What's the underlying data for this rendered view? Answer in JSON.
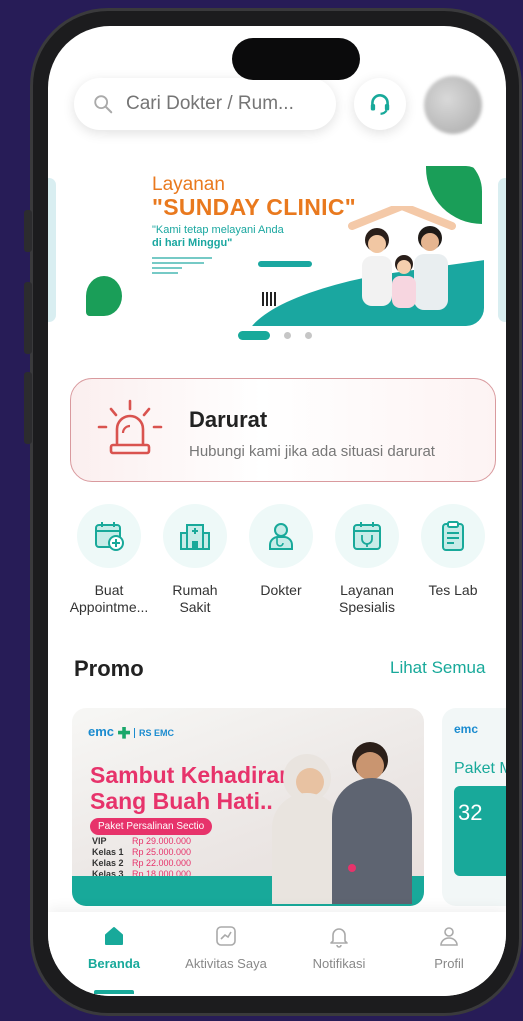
{
  "search": {
    "placeholder": "Cari Dokter / Rum..."
  },
  "banner": {
    "title_line1": "Layanan",
    "title_line2": "\"SUNDAY CLINIC\"",
    "tagline_line1": "\"Kami tetap melayani Anda",
    "tagline_line2": "di hari Minggu\"",
    "pagination": {
      "count": 3,
      "active_index": 0
    }
  },
  "emergency": {
    "title": "Darurat",
    "subtitle": "Hubungi kami jika ada situasi darurat"
  },
  "quick_menu": [
    {
      "label": "Buat\nAppointme...",
      "icon": "calendar-add-icon"
    },
    {
      "label": "Rumah\nSakit",
      "icon": "hospital-icon"
    },
    {
      "label": "Dokter",
      "icon": "doctor-icon"
    },
    {
      "label": "Layanan\nSpesialis",
      "icon": "specialist-calendar-icon"
    },
    {
      "label": "Tes Lab",
      "icon": "clipboard-icon"
    }
  ],
  "promo": {
    "title": "Promo",
    "see_all": "Lihat Semua",
    "cards": [
      {
        "brand": "emc",
        "hospital": "RS EMC",
        "headline_line1": "Sambut Kehadiran",
        "headline_line2": "Sang Buah Hati..",
        "badge": "Paket Persalinan Sectio",
        "prices": [
          {
            "class": "VIP",
            "price": "Rp 29.000.000"
          },
          {
            "class": "Kelas 1",
            "price": "Rp 25.000.000"
          },
          {
            "class": "Kelas 2",
            "price": "Rp 22.000.000"
          },
          {
            "class": "Kelas 3",
            "price": "Rp 18.000.000"
          }
        ]
      },
      {
        "brand": "emc",
        "headline": "Paket M",
        "price_partial": "32"
      }
    ]
  },
  "bottom_nav": [
    {
      "label": "Beranda",
      "icon": "home-icon",
      "active": true
    },
    {
      "label": "Aktivitas Saya",
      "icon": "activity-chart-icon",
      "active": false
    },
    {
      "label": "Notifikasi",
      "icon": "bell-icon",
      "active": false
    },
    {
      "label": "Profil",
      "icon": "user-icon",
      "active": false
    }
  ],
  "colors": {
    "background": "#271c57",
    "accent": "#18a99a",
    "banner_orange": "#e9791e",
    "emergency_red": "#d9534f",
    "promo_pink": "#e7336b"
  }
}
